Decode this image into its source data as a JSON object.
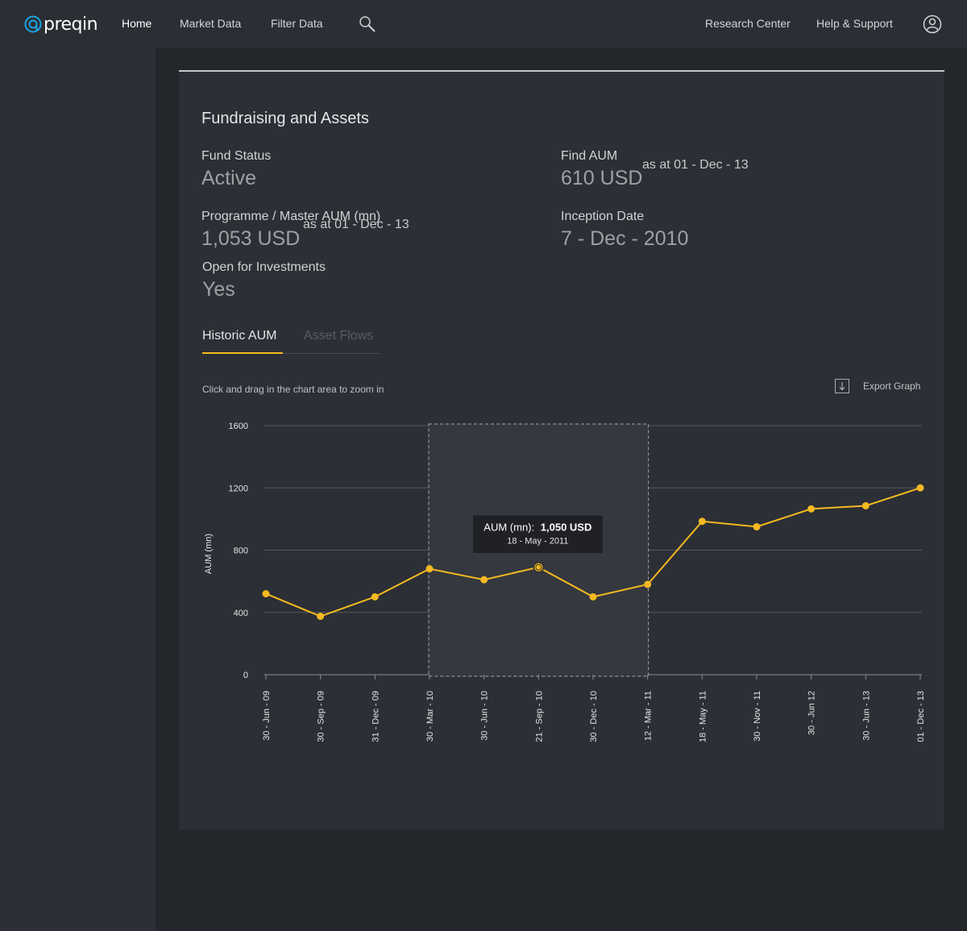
{
  "brand": {
    "name": "preqin",
    "accent": "#1aa3e0"
  },
  "nav": {
    "home": "Home",
    "market_data": "Market Data",
    "filter_data": "Filter Data",
    "research_center": "Research Center",
    "help_support": "Help & Support",
    "search_icon": "search-icon",
    "user_icon": "user-icon"
  },
  "fundraising": {
    "title": "Fundraising and Assets",
    "fund_status": {
      "label": "Fund Status",
      "value": "Active"
    },
    "fund_aum": {
      "label": "Find AUM",
      "value": "610 USD",
      "note": "as at 01 - Dec - 13"
    },
    "programme_aum": {
      "label": "Programme / Master AUM (mn)",
      "value": "1,053 USD",
      "note": "as at 01 - Dec - 13"
    },
    "inception_date": {
      "label": "Inception Date",
      "value": "7 - Dec - 2010"
    },
    "open_for_investments": {
      "label": "Open for Investments",
      "value": "Yes"
    }
  },
  "tabs": [
    {
      "label": "Historic AUM",
      "active": true
    },
    {
      "label": "Asset Flows",
      "active": false
    }
  ],
  "chart_hint": "Click and drag in the chart area to zoom in",
  "export_graph": {
    "label": "Export Graph",
    "icon": "download-icon"
  },
  "colors": {
    "line": "#f5b921",
    "background": "#2c2f35",
    "grid": "#55585d",
    "selection": "#35383e"
  },
  "chart_data": {
    "type": "line",
    "title": "",
    "xlabel": "",
    "ylabel": "AUM (mn)",
    "ylim": [
      0,
      1600
    ],
    "yticks": [
      0,
      400,
      800,
      1200,
      1600
    ],
    "grid": true,
    "x": [
      "30 - Jun - 09",
      "30 - Sep - 09",
      "31 - Dec - 09",
      "30 - Mar - 10",
      "30 - Jun - 10",
      "21 - Sep - 10",
      "30 - Dec - 10",
      "12 - Mar - 11",
      "18 - May - 11",
      "30 - Nov - 11",
      "30 - Jun 12",
      "30 - Jun - 13",
      "01 - Dec - 13"
    ],
    "series": [
      {
        "values": [
          520,
          375,
          500,
          680,
          610,
          690,
          500,
          580,
          985,
          950,
          1065,
          1085,
          1200
        ]
      }
    ],
    "selection_range": [
      "30 - Mar - 10",
      "12 - Mar - 11"
    ],
    "tooltip": {
      "label": "AUM (mn):",
      "value": "1,050 USD",
      "date": "18 - May - 2011",
      "point": "21 - Sep - 10"
    }
  }
}
